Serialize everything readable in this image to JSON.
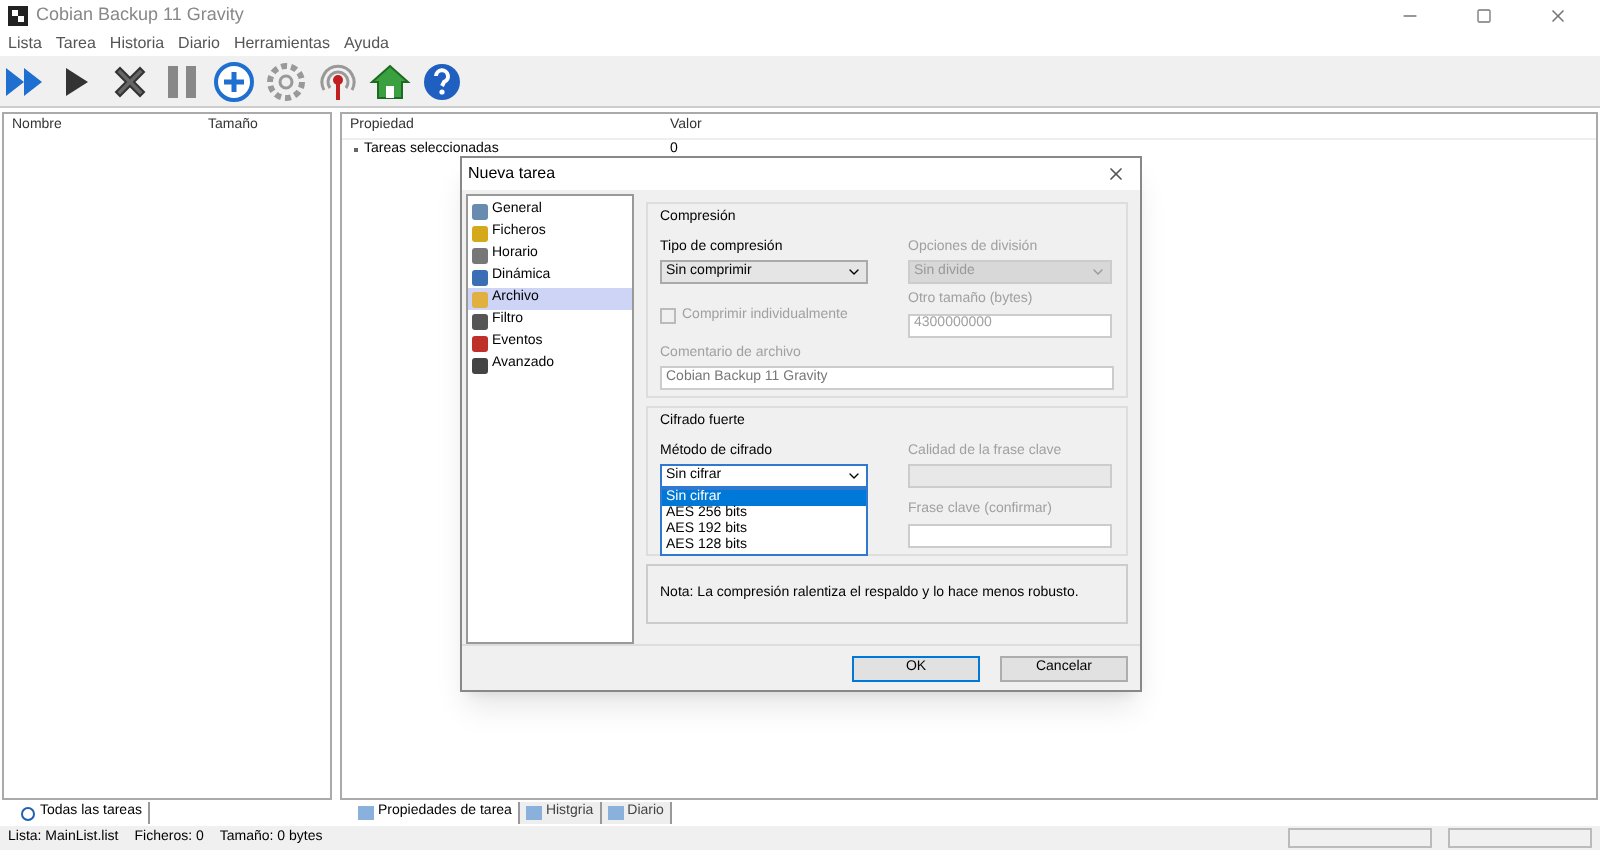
{
  "window": {
    "title": "Cobian Backup 11 Gravity"
  },
  "menu": [
    "Lista",
    "Tarea",
    "Historia",
    "Diario",
    "Herramientas",
    "Ayuda"
  ],
  "left_table": {
    "columns": [
      "Nombre",
      "Tamaño"
    ]
  },
  "right_table": {
    "columns": [
      "Propiedad",
      "Valor"
    ],
    "rows": [
      {
        "property": "Tareas seleccionadas",
        "value": "0"
      }
    ]
  },
  "left_tabs": [
    {
      "label": "Todas las tareas",
      "selected": true
    }
  ],
  "right_tabs": [
    {
      "label": "Propiedades de tarea",
      "selected": true
    },
    {
      "label": "Histgria",
      "selected": false
    },
    {
      "label": "Diario",
      "selected": false
    }
  ],
  "status_bar": [
    "Lista: MainList.list",
    "Ficheros: 0",
    "Tamaño: 0 bytes"
  ],
  "dialog": {
    "title": "Nueva tarea",
    "sections": [
      {
        "label": "General",
        "selected": false
      },
      {
        "label": "Ficheros",
        "selected": false
      },
      {
        "label": "Horario",
        "selected": false
      },
      {
        "label": "Dinámica",
        "selected": false
      },
      {
        "label": "Archivo",
        "selected": true
      },
      {
        "label": "Filtro",
        "selected": false
      },
      {
        "label": "Eventos",
        "selected": false
      },
      {
        "label": "Avanzado",
        "selected": false
      }
    ],
    "compression": {
      "title": "Compresión",
      "type_label": "Tipo de compresión",
      "type_value": "Sin comprimir",
      "split_label": "Opciones de división",
      "split_value": "Sin divide",
      "split_disabled": true,
      "individual": {
        "label": "Comprimir individualmente",
        "checked": false,
        "disabled": true
      },
      "size_label": "Otro tamaño (bytes)",
      "size_value": "4300000000",
      "comment_label": "Comentario de archivo",
      "comment_value": "Cobian Backup 11 Gravity"
    },
    "encryption": {
      "title": "Cifrado fuerte",
      "method_label": "Método de cifrado",
      "method_value": "Sin cifrar",
      "expanded": true,
      "options": [
        {
          "label": "Sin cifrar",
          "selected": true
        },
        {
          "label": "AES 256 bits",
          "selected": false
        },
        {
          "label": "AES 192 bits",
          "selected": false
        },
        {
          "label": "AES 128 bits",
          "selected": false
        }
      ],
      "quality_label": "Calidad de la frase clave",
      "confirm_label": "Frase clave (confirmar)",
      "passphrase_disabled": true
    },
    "note": "Nota: La compresión ralentiza el respaldo y lo hace menos robusto.",
    "buttons": [
      {
        "label": "OK",
        "default": true
      },
      {
        "label": "Cancelar",
        "default": false
      }
    ]
  }
}
